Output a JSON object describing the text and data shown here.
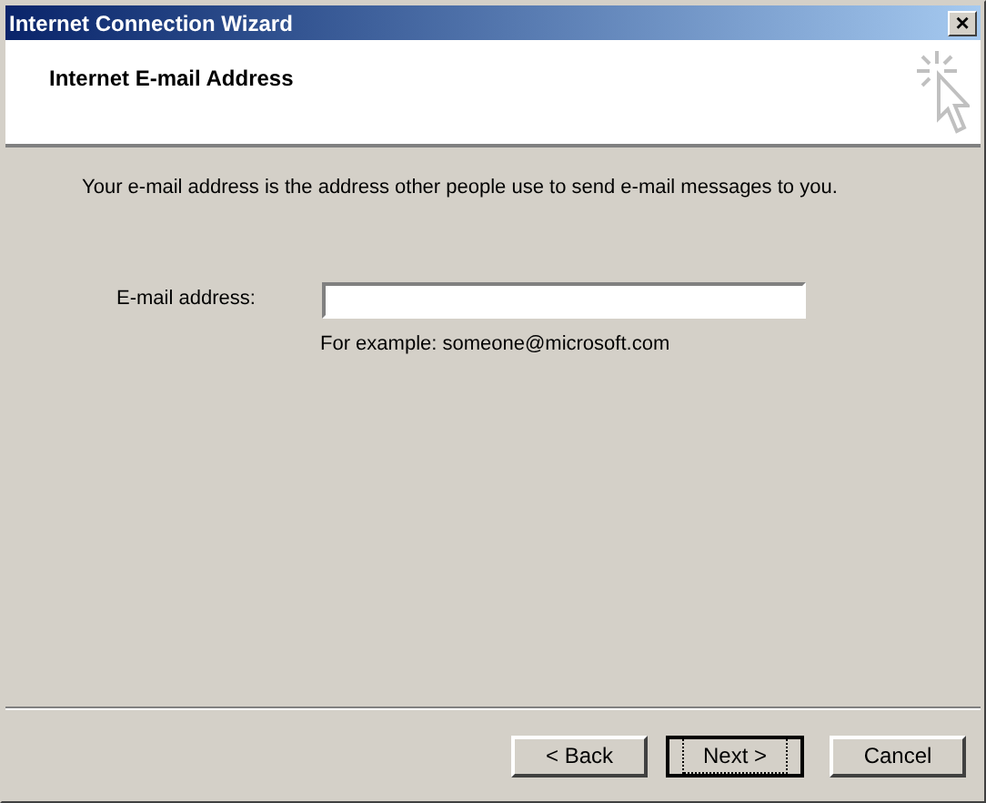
{
  "window": {
    "title": "Internet Connection Wizard",
    "close": "×"
  },
  "header": {
    "title": "Internet E-mail Address"
  },
  "intro": "Your e-mail address is the address other people use to send e-mail messages to you.",
  "field": {
    "label": "E-mail address:",
    "hint": "For example: someone@microsoft.com"
  },
  "buttons": [
    {
      "label": "< Back",
      "default": false
    },
    {
      "label": "Next >",
      "default": true
    },
    {
      "label": "Cancel",
      "default": false
    }
  ]
}
